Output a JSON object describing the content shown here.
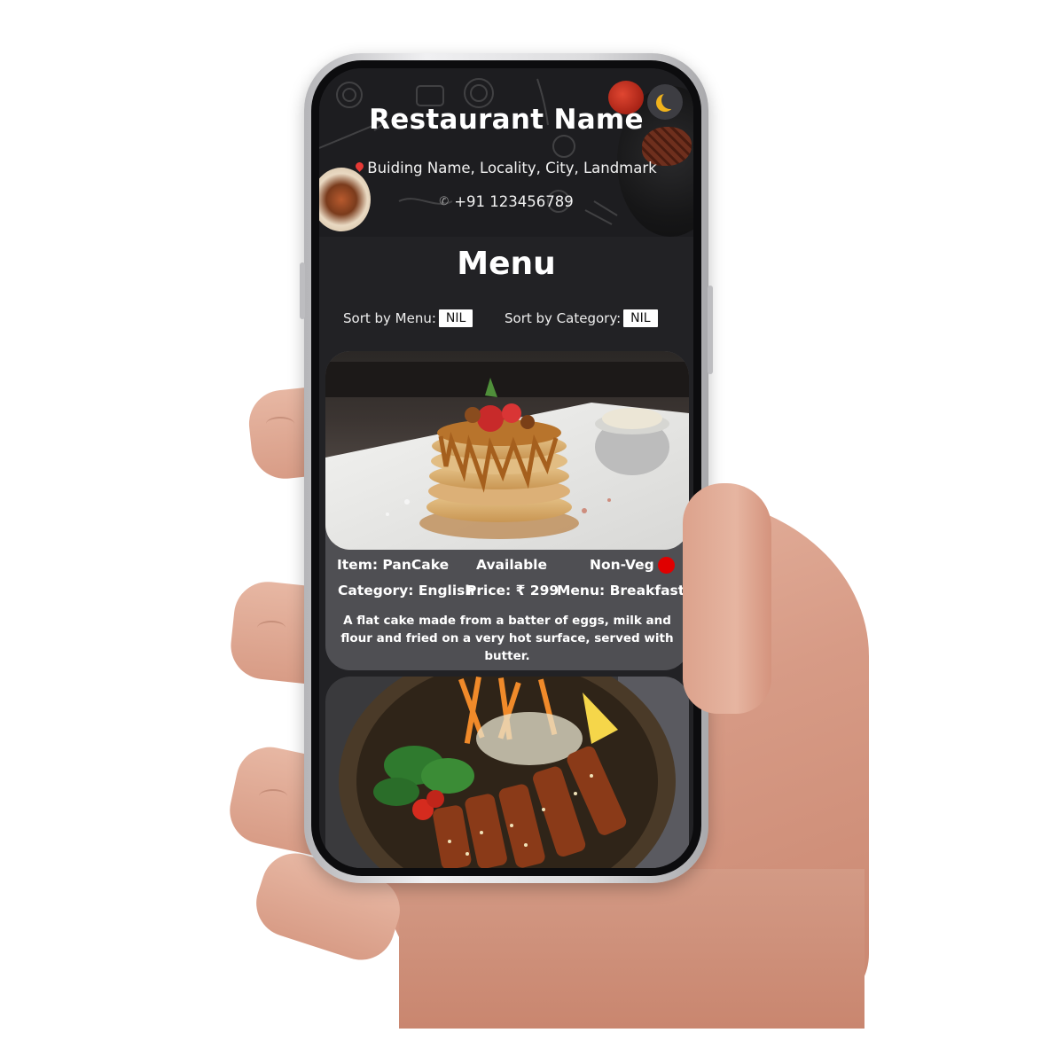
{
  "restaurant": {
    "name": "Restaurant Name",
    "address": "Buiding Name, Locality, City, Landmark",
    "phone": "+91 123456789"
  },
  "menu": {
    "title": "Menu",
    "filters": {
      "sort_by_menu_label": "Sort by Menu:",
      "sort_by_menu_value": "NIL",
      "sort_by_category_label": "Sort by Category:",
      "sort_by_category_value": "NIL"
    },
    "items": [
      {
        "item": "Item: PanCake",
        "availability": "Available",
        "type": "Non-Veg",
        "category": "Category: English",
        "price": "Price: ₹ 299",
        "menu": "Menu: Breakfast",
        "description": "A flat cake made from a batter of eggs, milk and flour and fried on a very hot surface, served with butter."
      }
    ]
  },
  "icons": {
    "theme_toggle": "moon-icon",
    "address": "map-pin-icon",
    "phone": "phone-icon",
    "non_veg_indicator": "red-dot-icon"
  },
  "colors": {
    "screen_bg": "#222225",
    "card_bg": "#4f4f53",
    "non_veg_dot": "#e00000",
    "moon": "#f0b21c"
  }
}
